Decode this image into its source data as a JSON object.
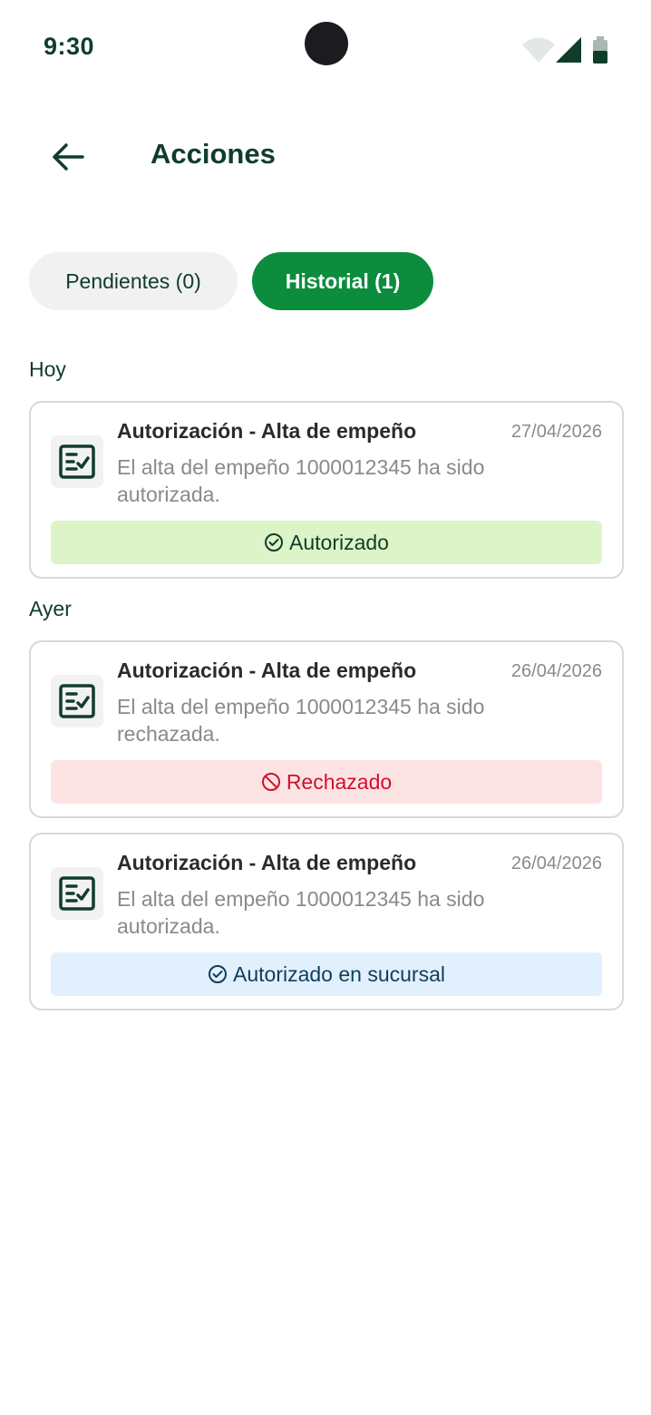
{
  "status_bar": {
    "time": "9:30"
  },
  "header": {
    "title": "Acciones"
  },
  "tabs": [
    {
      "label": "Pendientes (0)",
      "active": false
    },
    {
      "label": "Historial (1)",
      "active": true
    }
  ],
  "sections": [
    {
      "label": "Hoy"
    },
    {
      "label": "Ayer"
    }
  ],
  "cards": [
    {
      "title": "Autorización - Alta de empeño",
      "date": "27/04/2026",
      "message": "El alta del empeño 1000012345 ha sido autorizada.",
      "status": "Autorizado",
      "status_color": "#ddf4c8"
    },
    {
      "title": "Autorización - Alta de empeño",
      "date": "26/04/2026",
      "message": "El alta del empeño 1000012345 ha sido rechazada.",
      "status": "Rechazado",
      "status_color": "#fde4e4"
    },
    {
      "title": "Autorización - Alta de empeño",
      "date": "26/04/2026",
      "message": "El alta del empeño 1000012345 ha sido autorizada.",
      "status": "Autorizado en sucursal",
      "status_color": "#e2f0fd"
    }
  ],
  "colors": {
    "accent": "#0c8c3d",
    "text_primary": "#0f3d2a",
    "reject": "#d0102c"
  }
}
